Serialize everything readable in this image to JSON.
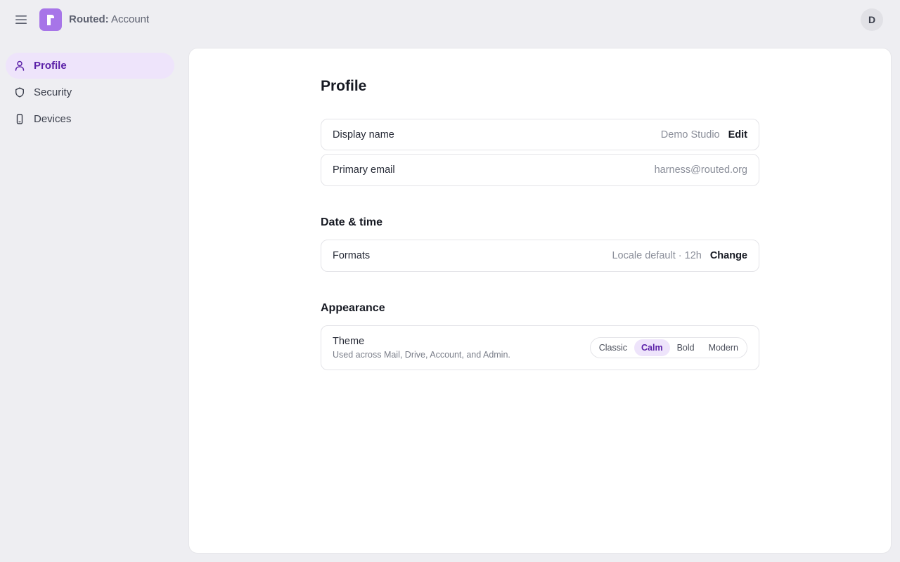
{
  "header": {
    "brand": "Routed:",
    "section": " Account",
    "avatar_initial": "D",
    "logo_letter": "r",
    "accent_color": "#a775e8"
  },
  "sidebar": {
    "items": [
      {
        "label": "Profile",
        "icon": "person-icon",
        "active": true
      },
      {
        "label": "Security",
        "icon": "shield-icon",
        "active": false
      },
      {
        "label": "Devices",
        "icon": "phone-icon",
        "active": false
      }
    ]
  },
  "main": {
    "title": "Profile",
    "rows": {
      "display_name": {
        "label": "Display name",
        "value": "Demo Studio",
        "action": "Edit"
      },
      "primary_email": {
        "label": "Primary email",
        "value": "harness@routed.org"
      }
    },
    "date_time": {
      "title": "Date & time",
      "formats": {
        "label": "Formats",
        "value": "Locale default · 12h",
        "action": "Change"
      }
    },
    "appearance": {
      "title": "Appearance",
      "theme": {
        "label": "Theme",
        "description": "Used across Mail, Drive, Account, and Admin.",
        "options": [
          "Classic",
          "Calm",
          "Bold",
          "Modern"
        ],
        "selected": "Calm"
      }
    }
  }
}
